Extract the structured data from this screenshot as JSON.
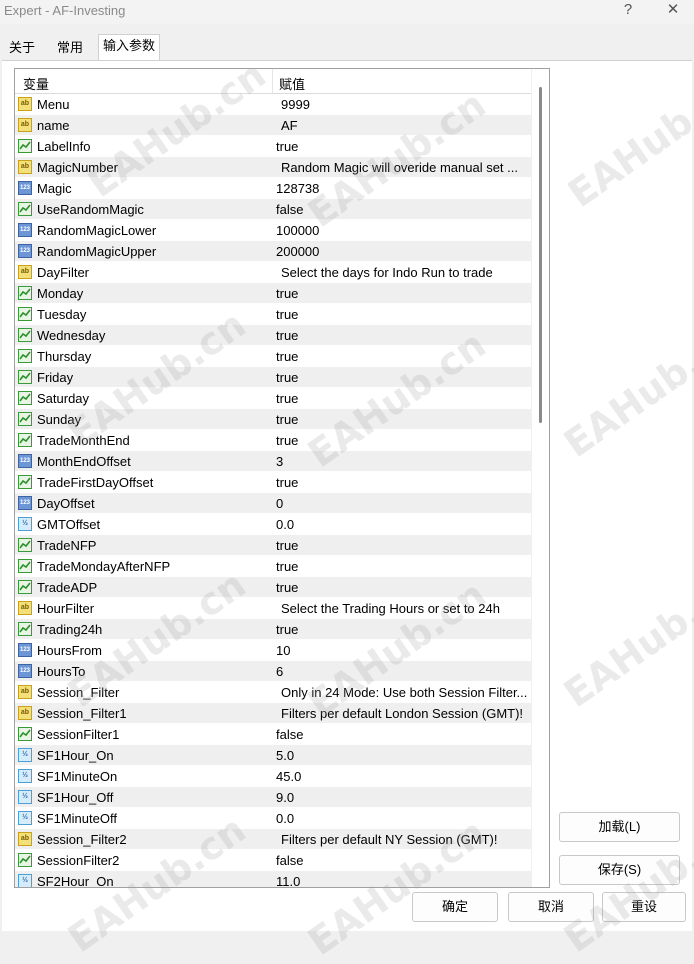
{
  "window": {
    "title": "Expert - AF-Investing",
    "help": "?",
    "close": "✕"
  },
  "tabs": [
    "关于",
    "常用",
    "输入参数"
  ],
  "table": {
    "col_variable": "变量",
    "col_value": "赋值",
    "rows": [
      {
        "type": "ab",
        "name": "Menu",
        "value": "9999"
      },
      {
        "type": "ab",
        "name": "name",
        "value": "AF"
      },
      {
        "type": "bool",
        "name": "LabelInfo",
        "value": "true"
      },
      {
        "type": "ab",
        "name": "MagicNumber",
        "value": "Random Magic will overide manual set ..."
      },
      {
        "type": "num",
        "name": "Magic",
        "value": "128738"
      },
      {
        "type": "bool",
        "name": "UseRandomMagic",
        "value": "false"
      },
      {
        "type": "num",
        "name": "RandomMagicLower",
        "value": "100000"
      },
      {
        "type": "num",
        "name": "RandomMagicUpper",
        "value": "200000"
      },
      {
        "type": "ab",
        "name": "DayFilter",
        "value": "Select the days for Indo Run to trade"
      },
      {
        "type": "bool",
        "name": "Monday",
        "value": "true"
      },
      {
        "type": "bool",
        "name": "Tuesday",
        "value": "true"
      },
      {
        "type": "bool",
        "name": "Wednesday",
        "value": "true"
      },
      {
        "type": "bool",
        "name": "Thursday",
        "value": "true"
      },
      {
        "type": "bool",
        "name": "Friday",
        "value": "true"
      },
      {
        "type": "bool",
        "name": "Saturday",
        "value": "true"
      },
      {
        "type": "bool",
        "name": "Sunday",
        "value": "true"
      },
      {
        "type": "bool",
        "name": "TradeMonthEnd",
        "value": "true"
      },
      {
        "type": "num",
        "name": "MonthEndOffset",
        "value": "3"
      },
      {
        "type": "bool",
        "name": "TradeFirstDayOffset",
        "value": "true"
      },
      {
        "type": "num",
        "name": "DayOffset",
        "value": "0"
      },
      {
        "type": "dbl",
        "name": "GMTOffset",
        "value": "0.0"
      },
      {
        "type": "bool",
        "name": "TradeNFP",
        "value": "true"
      },
      {
        "type": "bool",
        "name": "TradeMondayAfterNFP",
        "value": "true"
      },
      {
        "type": "bool",
        "name": "TradeADP",
        "value": "true"
      },
      {
        "type": "ab",
        "name": "HourFilter",
        "value": "Select the Trading Hours or set to 24h"
      },
      {
        "type": "bool",
        "name": "Trading24h",
        "value": "true"
      },
      {
        "type": "num",
        "name": "HoursFrom",
        "value": "10"
      },
      {
        "type": "num",
        "name": "HoursTo",
        "value": "6"
      },
      {
        "type": "ab",
        "name": "Session_Filter",
        "value": "Only in 24 Mode: Use both Session Filter..."
      },
      {
        "type": "ab",
        "name": "Session_Filter1",
        "value": "Filters per default London Session (GMT)!"
      },
      {
        "type": "bool",
        "name": "SessionFilter1",
        "value": "false"
      },
      {
        "type": "dbl",
        "name": "SF1Hour_On",
        "value": "5.0"
      },
      {
        "type": "dbl",
        "name": "SF1MinuteOn",
        "value": "45.0"
      },
      {
        "type": "dbl",
        "name": "SF1Hour_Off",
        "value": "9.0"
      },
      {
        "type": "dbl",
        "name": "SF1MinuteOff",
        "value": "0.0"
      },
      {
        "type": "ab",
        "name": "Session_Filter2",
        "value": "Filters per default NY Session (GMT)!"
      },
      {
        "type": "bool",
        "name": "SessionFilter2",
        "value": "false"
      },
      {
        "type": "dbl",
        "name": "SF2Hour_On",
        "value": "11.0"
      }
    ]
  },
  "icons": {
    "ab": "ab",
    "num": "123",
    "dbl": "½"
  },
  "buttons": {
    "load": "加载(L)",
    "save": "保存(S)",
    "ok": "确定",
    "cancel": "取消",
    "reset": "重设"
  },
  "watermark": "EAHub.cn"
}
